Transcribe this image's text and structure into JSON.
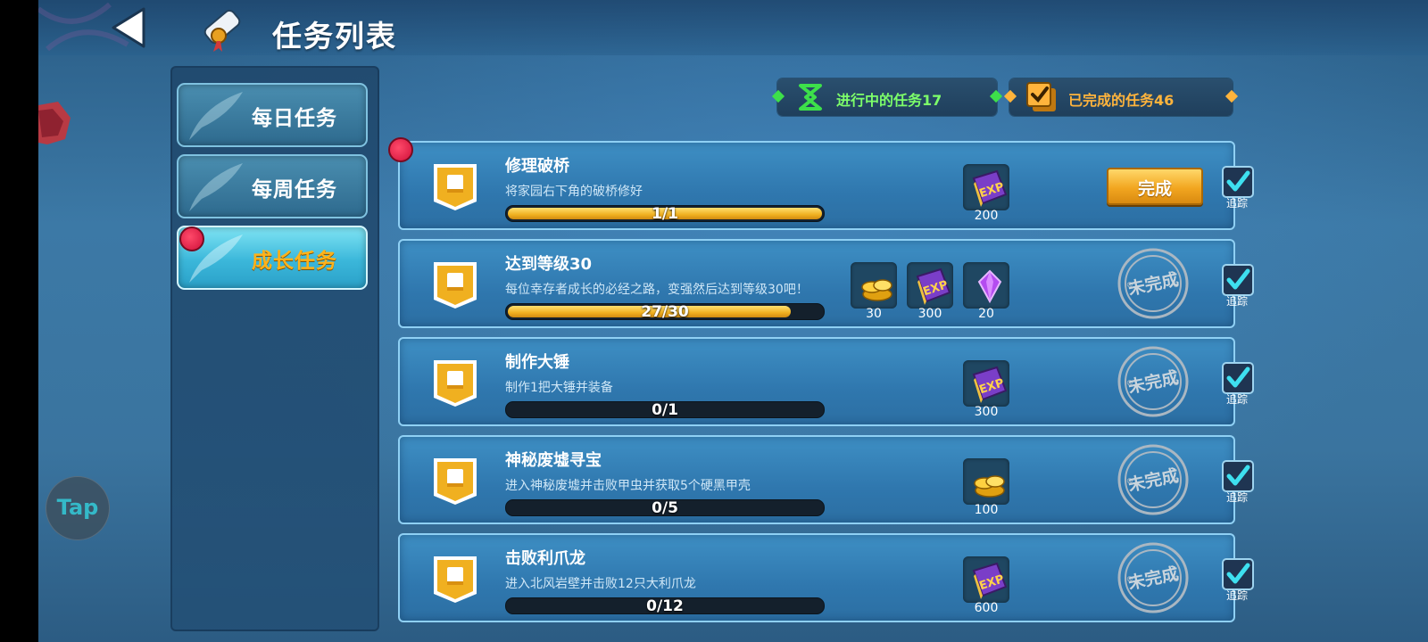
{
  "header": {
    "title": "任务列表"
  },
  "tabs": [
    {
      "label": "每日任务",
      "active": false,
      "alert": false
    },
    {
      "label": "每周任务",
      "active": false,
      "alert": false
    },
    {
      "label": "成长任务",
      "active": true,
      "alert": true
    }
  ],
  "counters": {
    "in_progress": "进行中的任务17",
    "completed": "已完成的任务46"
  },
  "tasks": [
    {
      "title": "修理破桥",
      "desc": "将家园右下角的破桥修好",
      "progress_text": "1/1",
      "progress": 1.0,
      "rewards": [
        {
          "icon": "exp-book-icon",
          "value": "200"
        }
      ],
      "status": "完成",
      "tracked": true,
      "alert": true
    },
    {
      "title": "达到等级30",
      "desc": "每位幸存者成长的必经之路，变强然后达到等级30吧！",
      "progress_text": "27/30",
      "progress": 0.9,
      "rewards": [
        {
          "icon": "gold-coins-icon",
          "value": "30"
        },
        {
          "icon": "exp-book-icon",
          "value": "300"
        },
        {
          "icon": "purple-gem-icon",
          "value": "20"
        }
      ],
      "status": "未完成",
      "tracked": true,
      "alert": false
    },
    {
      "title": "制作大锤",
      "desc": "制作1把大锤并装备",
      "progress_text": "0/1",
      "progress": 0.0,
      "rewards": [
        {
          "icon": "exp-book-icon",
          "value": "300"
        }
      ],
      "status": "未完成",
      "tracked": true,
      "alert": false
    },
    {
      "title": "神秘废墟寻宝",
      "desc": "进入神秘废墟并击败甲虫并获取5个硬黑甲壳",
      "progress_text": "0/5",
      "progress": 0.0,
      "rewards": [
        {
          "icon": "gold-coins-icon",
          "value": "100"
        }
      ],
      "status": "未完成",
      "tracked": true,
      "alert": false
    },
    {
      "title": "击败利爪龙",
      "desc": "进入北风岩壁并击败12只大利爪龙",
      "progress_text": "0/12",
      "progress": 0.0,
      "rewards": [
        {
          "icon": "exp-book-icon",
          "value": "600"
        }
      ],
      "status": "未完成",
      "tracked": true,
      "alert": false
    }
  ],
  "track_label": "追踪",
  "overlay": {
    "tap_label": "Tap"
  },
  "colors": {
    "accent_orange": "#ffb21a",
    "progress_green": "#7dff6a",
    "completed_gold": "#ffb43c"
  }
}
